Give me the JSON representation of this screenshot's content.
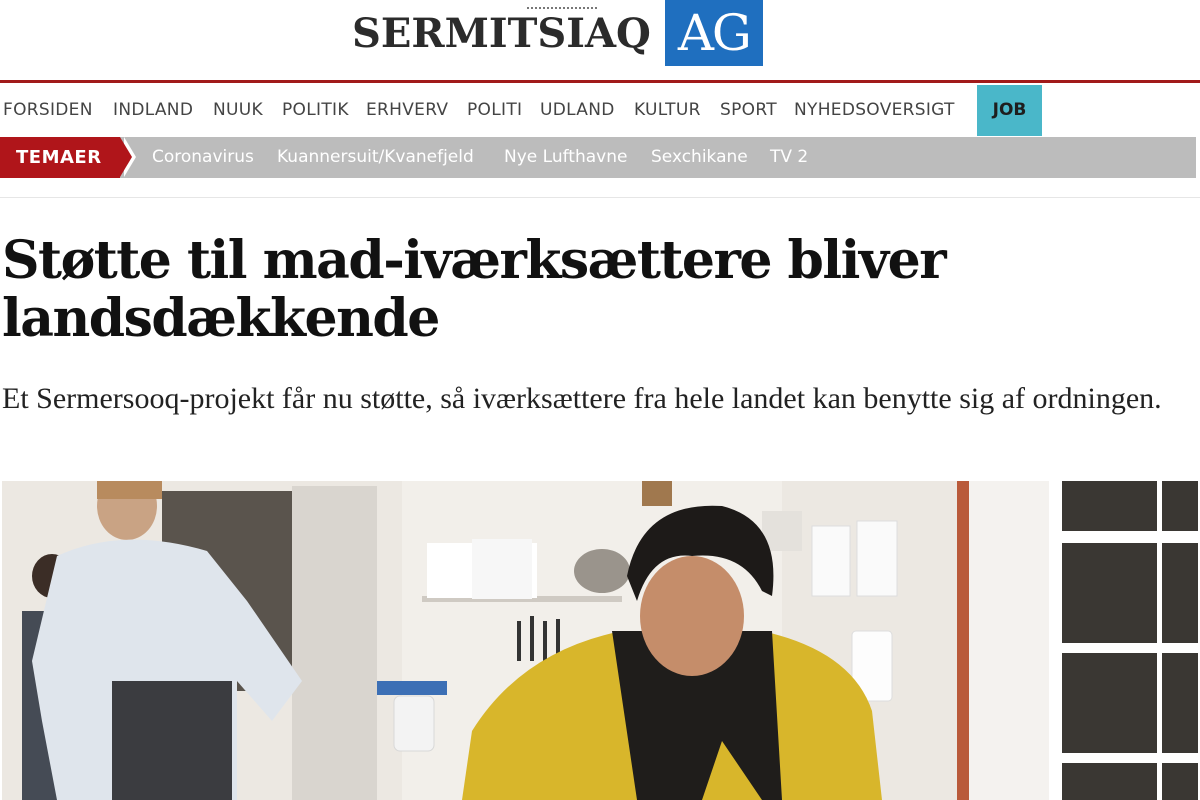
{
  "masthead": {
    "logo_text": "SERMITSIAQ",
    "logo_ag": "AG"
  },
  "nav": {
    "items": [
      "FORSIDEN",
      "INDLAND",
      "NUUK",
      "POLITIK",
      "ERHVERV",
      "POLITI",
      "UDLAND",
      "KULTUR",
      "SPORT",
      "NYHEDSOVERSIGT"
    ],
    "job_label": "JOB"
  },
  "themes": {
    "label": "TEMAER",
    "items": [
      "Coronavirus",
      "Kuannersuit/Kvanefjeld",
      "Nye Lufthavne",
      "Sexchikane",
      "TV 2"
    ]
  },
  "article": {
    "headline": "Støtte til mad-iværksættere bliver landsdækkende",
    "lead": "Et Sermersooq-projekt får nu støtte, så iværksættere fra hele landet kan benytte sig af ordningen."
  },
  "colors": {
    "brand_red": "#a11a1a",
    "brand_blue": "#1f6fbf",
    "job_teal": "#4ab7c9",
    "themes_gray": "#bcbcbc"
  }
}
